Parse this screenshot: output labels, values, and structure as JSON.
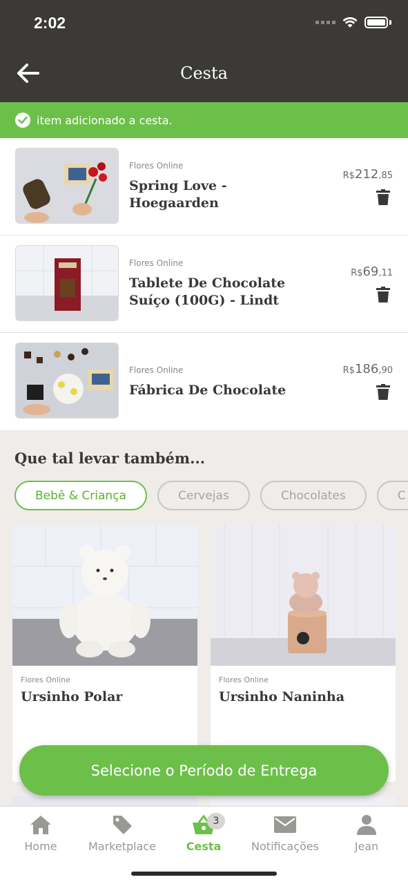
{
  "status_bar": {
    "time": "2:02"
  },
  "header": {
    "title": "Cesta"
  },
  "toast": {
    "message": "item adicionado a cesta."
  },
  "cart": {
    "items": [
      {
        "store": "Flores Online",
        "name_line1": "Spring Love -",
        "name_line2": "Hoegaarden",
        "currency": "R$",
        "price_int": "212",
        "price_dec": ",85"
      },
      {
        "store": "Flores Online",
        "name_line1": "Tablete De Chocolate",
        "name_line2": "Suíço (100G) - Lindt",
        "currency": "R$",
        "price_int": "69",
        "price_dec": ",11"
      },
      {
        "store": "Flores Online",
        "name_line1": "Fábrica De Chocolate",
        "name_line2": "",
        "currency": "R$",
        "price_int": "186",
        "price_dec": ",90"
      }
    ]
  },
  "suggestions": {
    "title": "Que tal levar também...",
    "chips": [
      "Bebê & Criança",
      "Cervejas",
      "Chocolates",
      "C"
    ],
    "products": [
      {
        "store": "Flores Online",
        "name": "Ursinho Polar"
      },
      {
        "store": "Flores Online",
        "name": "Ursinho Naninha"
      }
    ]
  },
  "cta": {
    "label": "Selecione o Período de Entrega"
  },
  "tabbar": {
    "tabs": [
      {
        "label": "Home",
        "icon": "home-icon"
      },
      {
        "label": "Marketplace",
        "icon": "tag-icon"
      },
      {
        "label": "Cesta",
        "icon": "basket-icon",
        "badge": "3"
      },
      {
        "label": "Notificações",
        "icon": "mail-icon"
      },
      {
        "label": "Jean",
        "icon": "user-icon"
      }
    ]
  },
  "colors": {
    "accent": "#6cc04a",
    "header_bg": "#3b3a36",
    "suggest_bg": "#efecea"
  }
}
